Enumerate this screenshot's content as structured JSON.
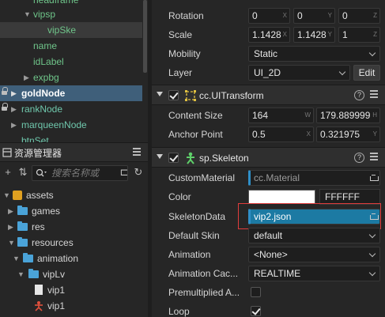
{
  "hierarchy": {
    "items": [
      {
        "label": "headframe"
      },
      {
        "label": "vipsp"
      },
      {
        "label": "vipSke"
      },
      {
        "label": "name"
      },
      {
        "label": "idLabel"
      },
      {
        "label": "expbg"
      },
      {
        "label": "goldNode"
      },
      {
        "label": "rankNode"
      },
      {
        "label": "marqueenNode"
      },
      {
        "label": "btnSet"
      }
    ]
  },
  "assets_panel": {
    "title": "资源管理器",
    "search_placeholder": "搜索名称或",
    "tree": [
      {
        "label": "assets"
      },
      {
        "label": "games"
      },
      {
        "label": "res"
      },
      {
        "label": "resources"
      },
      {
        "label": "animation"
      },
      {
        "label": "vipLv"
      },
      {
        "label": "vip1"
      },
      {
        "label": "vip1"
      }
    ]
  },
  "inspector": {
    "transform": {
      "rotation": {
        "label": "Rotation",
        "x": "0",
        "y": "0",
        "z": "0"
      },
      "scale": {
        "label": "Scale",
        "x": "1.1428",
        "y": "1.1428",
        "z": "1"
      },
      "mobility": {
        "label": "Mobility",
        "value": "Static"
      },
      "layer": {
        "label": "Layer",
        "value": "UI_2D",
        "edit_label": "Edit"
      }
    },
    "ui_transform": {
      "title": "cc.UITransform",
      "content_size": {
        "label": "Content Size",
        "w": "164",
        "h": "179.889999"
      },
      "anchor_point": {
        "label": "Anchor Point",
        "x": "0.5",
        "y": "0.321975"
      }
    },
    "skeleton": {
      "title": "sp.Skeleton",
      "custom_material": {
        "label": "CustomMaterial",
        "value": "cc.Material"
      },
      "color": {
        "label": "Color",
        "hex": "FFFFFF",
        "swatch": "#ffffff"
      },
      "skeleton_data": {
        "label": "SkeletonData",
        "value": "vip2.json"
      },
      "default_skin": {
        "label": "Default Skin",
        "value": "default"
      },
      "animation": {
        "label": "Animation",
        "value": "<None>"
      },
      "animation_cache": {
        "label": "Animation Cac...",
        "value": "REALTIME"
      },
      "premultiplied_alpha": {
        "label": "Premultiplied A...",
        "checked": false
      },
      "loop": {
        "label": "Loop",
        "checked": true
      }
    },
    "axis_letters": {
      "x": "X",
      "y": "Y",
      "z": "Z",
      "w": "W",
      "h": "H"
    }
  },
  "colors": {
    "accent_blue": "#1c7aa3",
    "highlight_red": "#e03c3c",
    "node_green": "#6fc58a"
  }
}
